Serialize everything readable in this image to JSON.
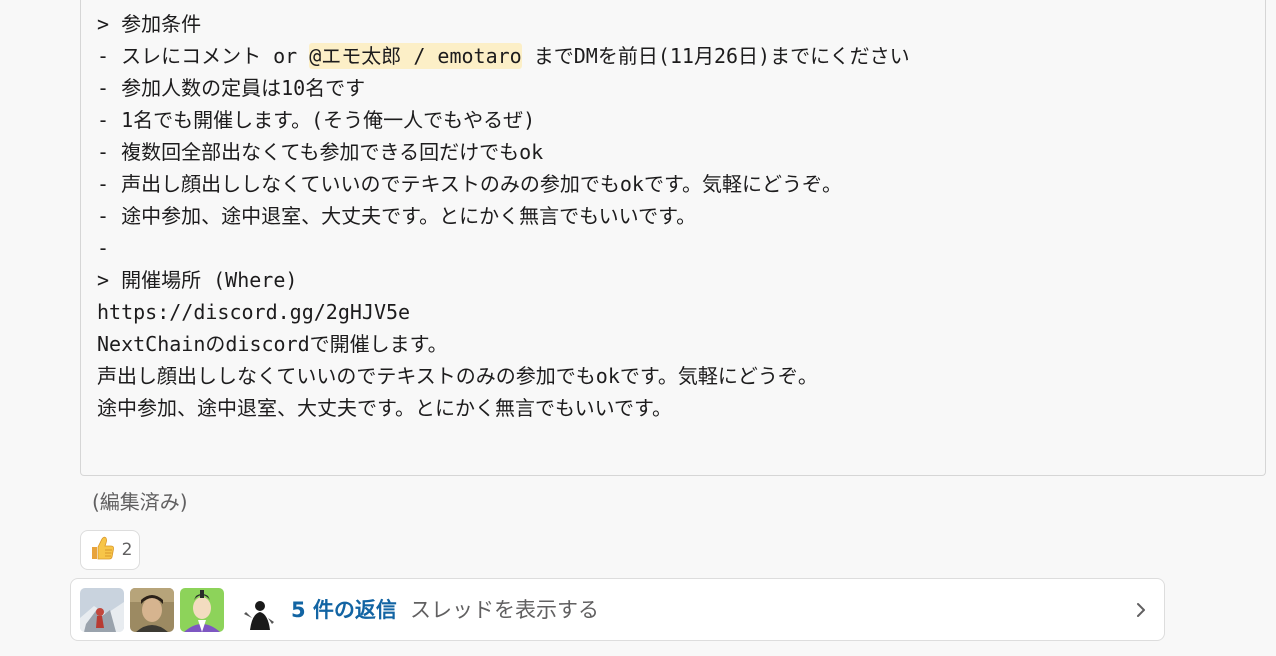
{
  "code_block": {
    "lines": [
      "> 参加条件",
      "- 参加人数の定員は10名です",
      "- 1名でも開催します。(そう俺一人でもやるぜ)",
      "- 複数回全部出なくても参加できる回だけでもok",
      "- 声出し顔出ししなくていいのでテキストのみの参加でもokです。気軽にどうぞ。",
      "- 途中参加、途中退室、大丈夫です。とにかく無言でもいいです。",
      "-",
      "> 開催場所 (Where)",
      "https://discord.gg/2gHJV5e",
      "NextChainのdiscordで開催します。",
      "声出し顔出ししなくていいのでテキストのみの参加でもokです。気軽にどうぞ。",
      "途中参加、途中退室、大丈夫です。とにかく無言でもいいです。"
    ],
    "mention_line": {
      "before": "- スレにコメント or ",
      "mention": "@エモ太郎 / emotaro",
      "after": " までDMを前日(11月26日)までにください"
    }
  },
  "edited_label": "(編集済み)",
  "reaction": {
    "emoji_name": "thumbs-up",
    "count": "2"
  },
  "thread": {
    "reply_count_label": "5 件の返信",
    "view_thread_label": "スレッドを表示する",
    "avatars": [
      "user-avatar-1",
      "user-avatar-2",
      "user-avatar-3",
      "user-avatar-4"
    ]
  },
  "colors": {
    "link": "#1264a3",
    "mention_bg": "#fcefc7",
    "text": "#1d1c1d",
    "muted": "#616061"
  }
}
